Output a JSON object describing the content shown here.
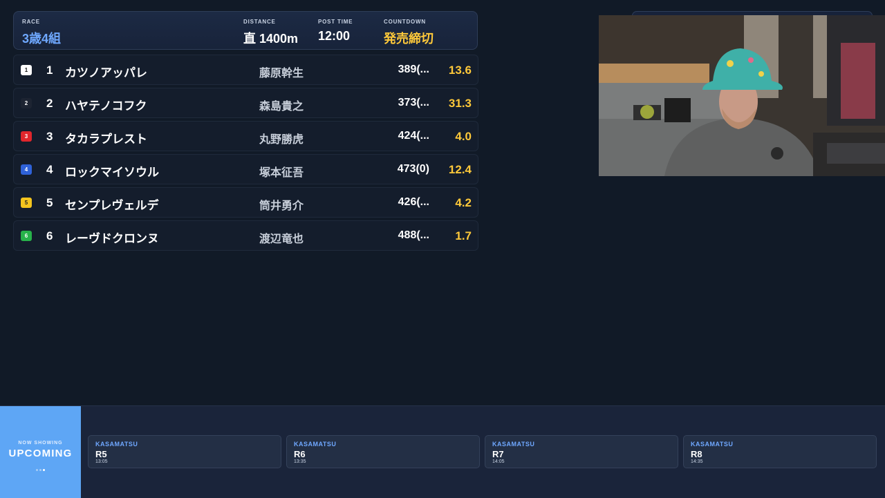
{
  "race_header": {
    "race_label": "RACE",
    "race_value": "3歳4組",
    "distance_label": "DISTANCE",
    "distance_value": "直 1400m",
    "post_time_label": "POST TIME",
    "post_time_value": "12:00",
    "countdown_label": "COUNTDOWN",
    "countdown_value": "発売締切"
  },
  "runners": [
    {
      "badge": "1",
      "num": "1",
      "name": "カツノアッパレ",
      "jockey": "藤原幹生",
      "weight": "389(...",
      "odds": "13.6",
      "badge_bg": "#ffffff",
      "badge_fg": "#111111"
    },
    {
      "badge": "2",
      "num": "2",
      "name": "ハヤテノコフク",
      "jockey": "森島貴之",
      "weight": "373(...",
      "odds": "31.3",
      "badge_bg": "#1d2432",
      "badge_fg": "#ffffff"
    },
    {
      "badge": "3",
      "num": "3",
      "name": "タカラプレスト",
      "jockey": "丸野勝虎",
      "weight": "424(...",
      "odds": "4.0",
      "badge_bg": "#e0262c",
      "badge_fg": "#ffffff"
    },
    {
      "badge": "4",
      "num": "4",
      "name": "ロックマイソウル",
      "jockey": "塚本征吾",
      "weight": "473(0)",
      "odds": "12.4",
      "badge_bg": "#2f62d8",
      "badge_fg": "#ffffff"
    },
    {
      "badge": "5",
      "num": "5",
      "name": "センプレヴェルデ",
      "jockey": "筒井勇介",
      "weight": "426(...",
      "odds": "4.2",
      "badge_bg": "#f3c41e",
      "badge_fg": "#222222"
    },
    {
      "badge": "6",
      "num": "6",
      "name": "レーヴドクロンヌ",
      "jockey": "渡辺竜也",
      "weight": "488(...",
      "odds": "1.7",
      "badge_bg": "#27b24a",
      "badge_fg": "#ffffff"
    }
  ],
  "now_showing": {
    "small_label": "NOW SHOWING",
    "big_label": "UPCOMING"
  },
  "upcoming": [
    {
      "venue": "KASAMATSU",
      "race": "R5",
      "time": "13:05"
    },
    {
      "venue": "KASAMATSU",
      "race": "R6",
      "time": "13:35"
    },
    {
      "venue": "KASAMATSU",
      "race": "R7",
      "time": "14:05"
    },
    {
      "venue": "KASAMATSU",
      "race": "R8",
      "time": "14:35"
    }
  ],
  "colors": {
    "accent_blue": "#6fa8ff",
    "accent_gold": "#ffc93a",
    "now_showing_bg": "#5ea6f5"
  }
}
